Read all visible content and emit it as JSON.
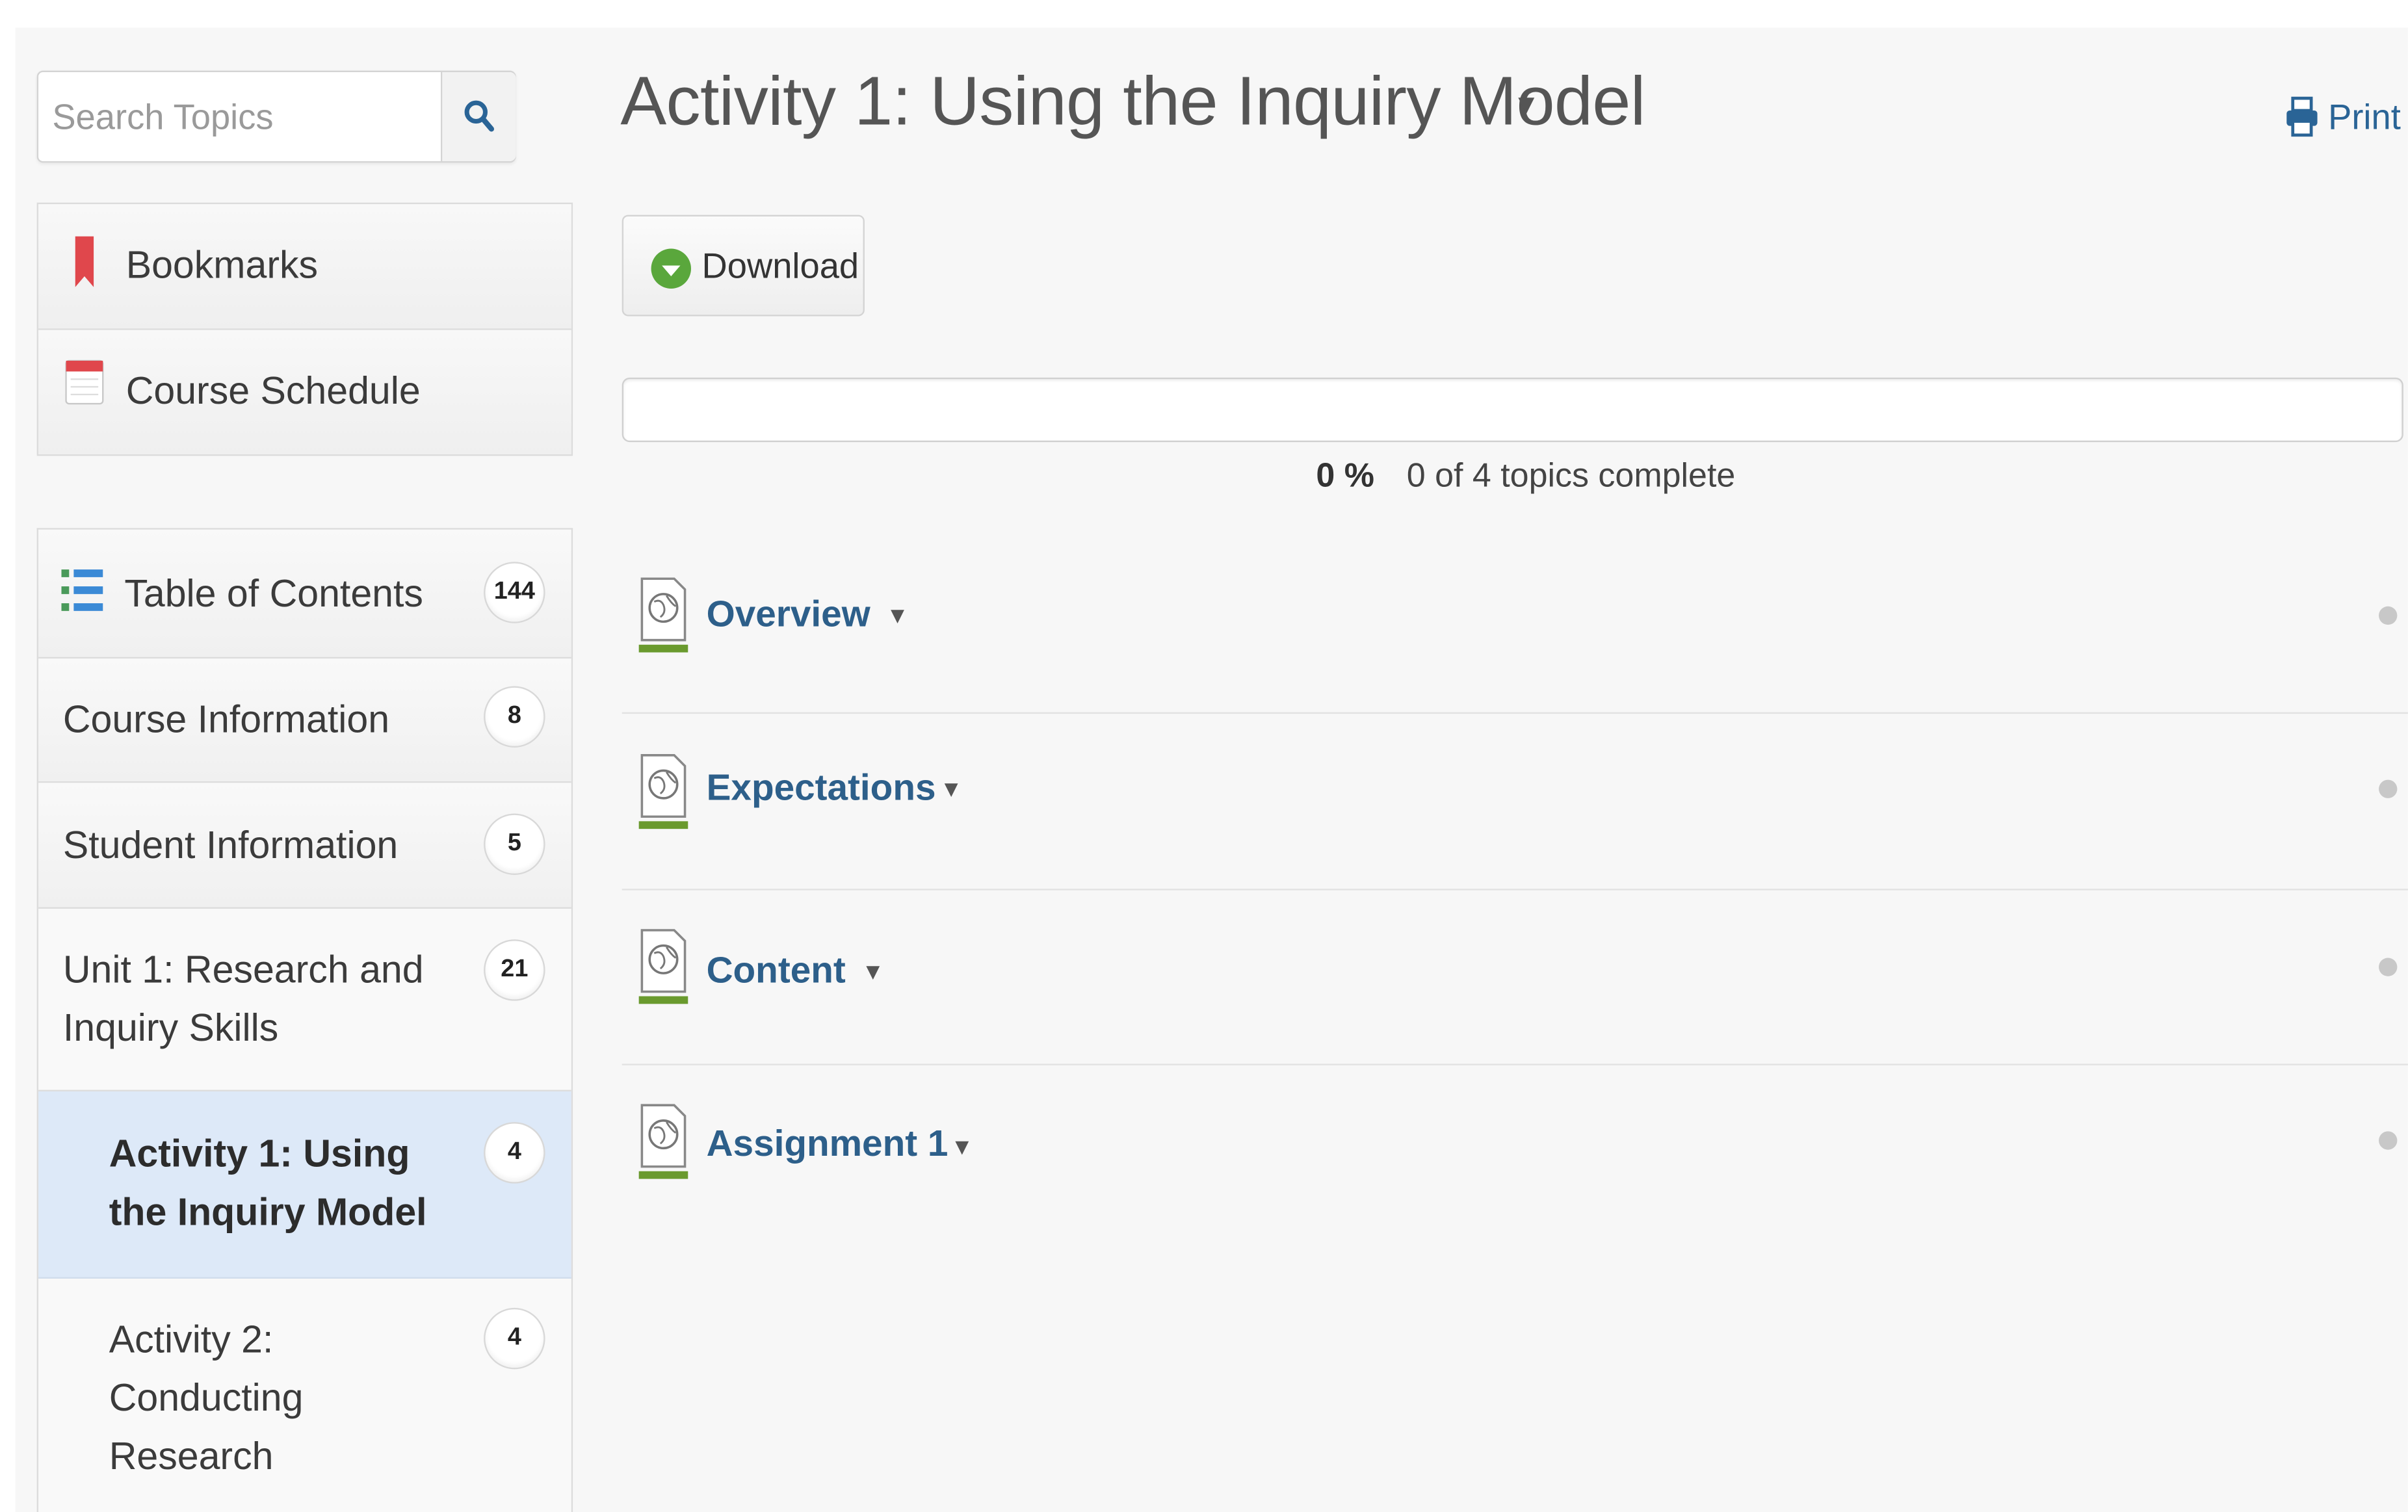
{
  "search": {
    "placeholder": "Search Topics"
  },
  "quick_nav": [
    {
      "label": "Bookmarks",
      "icon": "bookmark-icon"
    },
    {
      "label": "Course Schedule",
      "icon": "calendar-icon"
    }
  ],
  "toc": {
    "items": [
      {
        "label": "Table of Contents",
        "count": "144",
        "icon": "list-icon"
      },
      {
        "label": "Course Information",
        "count": "8"
      },
      {
        "label": "Student Information",
        "count": "5"
      },
      {
        "label_line1": "Unit 1: Research and",
        "label_line2": "Inquiry Skills",
        "count": "21"
      },
      {
        "label_line1": "Activity 1: Using",
        "label_line2": "the Inquiry Model",
        "count": "4",
        "active": true
      },
      {
        "label_line1": "Activity 2:",
        "label_line2": "Conducting",
        "label_line3": "Research",
        "count": "4"
      }
    ]
  },
  "main": {
    "title": "Activity 1: Using the Inquiry Model",
    "print_label": "Print",
    "download_label": "Download",
    "progress": {
      "percent_label": "0 %",
      "text": "0 of 4 topics complete",
      "fraction": 0
    },
    "topics": [
      {
        "title": "Overview"
      },
      {
        "title": "Expectations"
      },
      {
        "title": "Content"
      },
      {
        "title": "Assignment 1"
      }
    ]
  },
  "colors": {
    "link": "#2d5f8a",
    "active_bg": "#dde9f8",
    "accent_green": "#6a9a2e",
    "bookmark_red": "#e0474c"
  }
}
